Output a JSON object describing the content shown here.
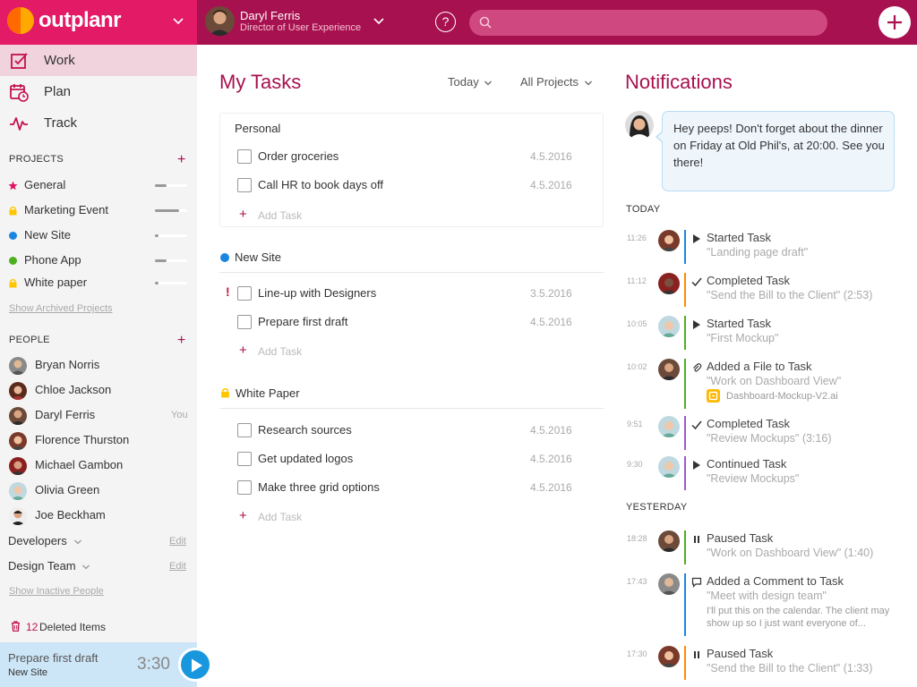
{
  "header": {
    "app_name": "outplanr",
    "user_name": "Daryl Ferris",
    "user_role": "Director of User Experience",
    "help_label": "?",
    "search_placeholder": ""
  },
  "sidebar": {
    "nav": [
      {
        "label": "Work",
        "icon": "work-check-icon",
        "active": true
      },
      {
        "label": "Plan",
        "icon": "calendar-clock-icon",
        "active": false
      },
      {
        "label": "Track",
        "icon": "pulse-icon",
        "active": false
      }
    ],
    "projects_title": "PROJECTS",
    "projects": [
      {
        "label": "General",
        "color": "#e0115f",
        "marker": "star",
        "progress": 0.35
      },
      {
        "label": "Marketing Event",
        "color": "#ffc600",
        "marker": "lock",
        "progress": 0.75
      },
      {
        "label": "New Site",
        "color": "#1a86e0",
        "marker": "dot",
        "progress": 0.1
      },
      {
        "label": "Phone App",
        "color": "#4caf1f",
        "marker": "dot",
        "progress": 0.35
      },
      {
        "label": "White paper",
        "color": "#ffc600",
        "marker": "lock",
        "progress": 0.1
      }
    ],
    "show_archived": "Show Archived Projects",
    "people_title": "PEOPLE",
    "people": [
      {
        "name": "Bryan Norris",
        "you": ""
      },
      {
        "name": "Chloe Jackson",
        "you": ""
      },
      {
        "name": "Daryl Ferris",
        "you": "You"
      },
      {
        "name": "Florence Thurston",
        "you": ""
      },
      {
        "name": "Michael Gambon",
        "you": ""
      },
      {
        "name": "Olivia Green",
        "you": ""
      },
      {
        "name": "Joe Beckham",
        "you": ""
      }
    ],
    "groups": [
      {
        "label": "Developers",
        "edit": "Edit"
      },
      {
        "label": "Design Team",
        "edit": "Edit"
      }
    ],
    "show_inactive": "Show Inactive People",
    "deleted_count": "12",
    "deleted_label": "Deleted Items",
    "timer": {
      "task": "Prepare first draft",
      "project": "New Site",
      "time": "3:30"
    }
  },
  "tasks": {
    "title": "My Tasks",
    "filter_date": "Today",
    "filter_project": "All Projects",
    "add_task_label": "Add Task",
    "groups": [
      {
        "name": "Personal",
        "tasks": [
          {
            "label": "Order groceries",
            "date": "4.5.2016",
            "priority": ""
          },
          {
            "label": "Call HR to book days off",
            "date": "4.5.2016",
            "priority": ""
          }
        ]
      },
      {
        "name": "New Site",
        "color": "#1a86e0",
        "tasks": [
          {
            "label": "Line-up with Designers",
            "date": "3.5.2016",
            "priority": "!"
          },
          {
            "label": "Prepare first draft",
            "date": "4.5.2016",
            "priority": ""
          }
        ]
      },
      {
        "name": "White Paper",
        "color": "#ffc600",
        "tasks": [
          {
            "label": "Research sources",
            "date": "4.5.2016",
            "priority": ""
          },
          {
            "label": "Get updated logos",
            "date": "4.5.2016",
            "priority": ""
          },
          {
            "label": "Make three grid options",
            "date": "4.5.2016",
            "priority": ""
          }
        ]
      }
    ]
  },
  "notifications": {
    "title": "Notifications",
    "message": "Hey peeps! Don't forget about the dinner on Friday at Old Phil's, at 20:00. See you there!",
    "today_label": "TODAY",
    "yesterday_label": "YESTERDAY",
    "today": [
      {
        "time": "11:26",
        "action": "Started Task",
        "detail": "\"Landing page draft\"",
        "icon": "play-icon",
        "color": "#1a86e0"
      },
      {
        "time": "11:12",
        "action": "Completed Task",
        "detail": "\"Send the Bill to the Client\" (2:53)",
        "icon": "check-icon",
        "color": "#ff8a00"
      },
      {
        "time": "10:05",
        "action": "Started Task",
        "detail": "\"First Mockup\"",
        "icon": "play-icon",
        "color": "#4caf1f"
      },
      {
        "time": "10:02",
        "action": "Added a File to Task",
        "detail": "\"Work on Dashboard View\"",
        "icon": "paperclip-icon",
        "color": "#4caf1f",
        "file": "Dashboard-Mockup-V2.ai"
      },
      {
        "time": "9:51",
        "action": "Completed Task",
        "detail": "\"Review Mockups\" (3:16)",
        "icon": "check-icon",
        "color": "#9b59d0"
      },
      {
        "time": "9:30",
        "action": "Continued Task",
        "detail": "\"Review Mockups\"",
        "icon": "play-icon",
        "color": "#9b59d0"
      }
    ],
    "yesterday": [
      {
        "time": "18:28",
        "action": "Paused Task",
        "detail": "\"Work on Dashboard View\" (1:40)",
        "icon": "pause-icon",
        "color": "#4caf1f"
      },
      {
        "time": "17:43",
        "action": "Added a Comment to Task",
        "detail": "\"Meet with design team\"",
        "icon": "comment-icon",
        "color": "#1a86e0",
        "comment": "I'll put this on the calendar. The client may show up so I just want everyone of..."
      },
      {
        "time": "17:30",
        "action": "Paused Task",
        "detail": "\"Send the Bill to the Client\" (1:33)",
        "icon": "pause-icon",
        "color": "#ff8a00"
      }
    ]
  }
}
